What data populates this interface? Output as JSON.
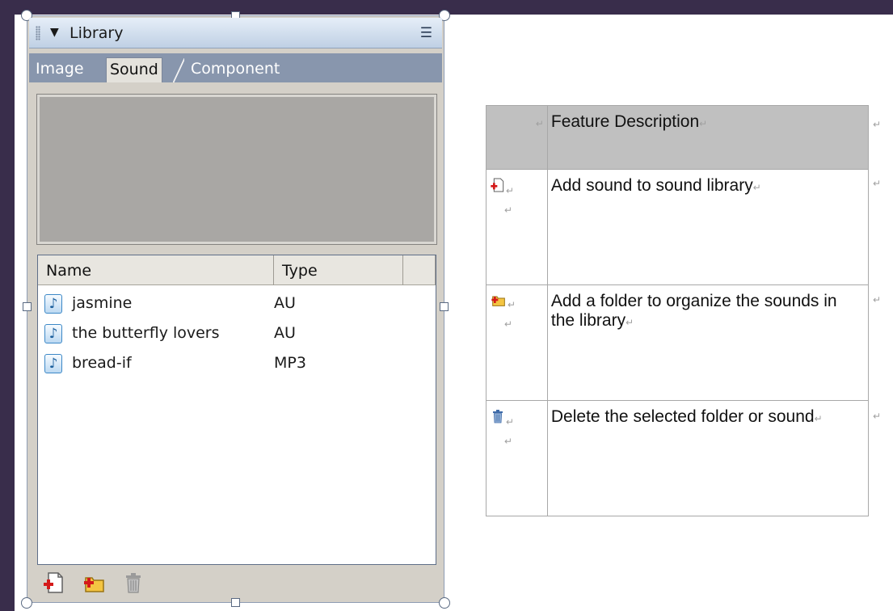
{
  "panel": {
    "title": "Library",
    "collapse_icon": "triangle-down-icon",
    "menu_icon": "panel-options-icon",
    "tabs": [
      {
        "label": "Image",
        "selected": false
      },
      {
        "label": "Sound",
        "selected": true
      },
      {
        "label": "Component",
        "selected": false
      }
    ],
    "list": {
      "columns": [
        "Name",
        "Type"
      ],
      "rows": [
        {
          "name": "jasmine",
          "type": "AU",
          "icon": "sound-note-icon"
        },
        {
          "name": "the butterfly lovers",
          "type": "AU",
          "icon": "sound-note-icon"
        },
        {
          "name": "bread-if",
          "type": "MP3",
          "icon": "sound-note-icon"
        }
      ]
    },
    "toolbar": [
      {
        "icon": "add-sound-icon"
      },
      {
        "icon": "add-folder-icon"
      },
      {
        "icon": "trash-icon"
      }
    ]
  },
  "feature_table": {
    "header": {
      "feature": "",
      "description": "Feature Description"
    },
    "rows": [
      {
        "icon": "add-sound-icon",
        "description": "Add sound to sound library"
      },
      {
        "icon": "add-folder-icon",
        "description": "Add a folder to organize the sounds in the library"
      },
      {
        "icon": "trash-icon",
        "description": "Delete the selected folder or sound"
      }
    ],
    "paragraph_mark": "↵"
  },
  "colors": {
    "frame": "#392d4b",
    "panel_bg": "#d4d0c8",
    "tab_bar": "#8896ad",
    "preview": "#a9a7a4",
    "table_header": "#c0c0c0"
  }
}
